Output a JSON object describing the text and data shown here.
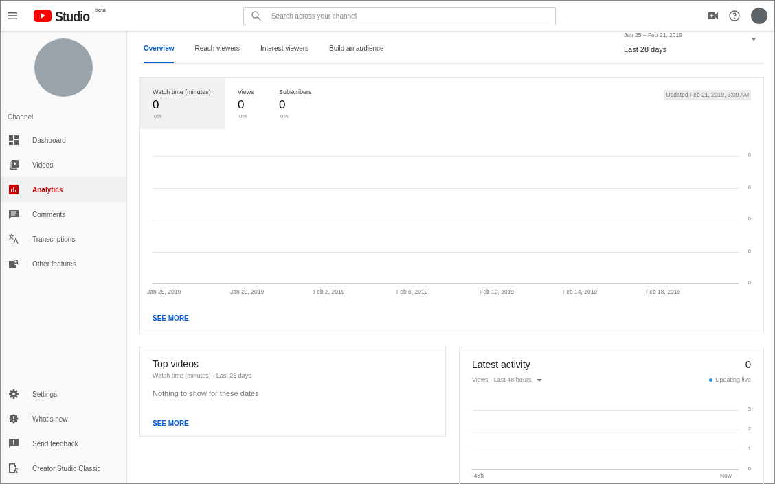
{
  "header": {
    "logo_text": "Studio",
    "logo_badge": "beta",
    "search": {
      "placeholder": "Search across your channel"
    }
  },
  "sidebar": {
    "section_label": "Channel",
    "items": [
      {
        "label": "Dashboard",
        "selected": false
      },
      {
        "label": "Videos",
        "selected": false
      },
      {
        "label": "Analytics",
        "selected": true
      },
      {
        "label": "Comments",
        "selected": false
      },
      {
        "label": "Transcriptions",
        "selected": false
      },
      {
        "label": "Other features",
        "selected": false
      }
    ],
    "footer_items": [
      {
        "label": "Settings"
      },
      {
        "label": "What’s new"
      },
      {
        "label": "Send feedback"
      },
      {
        "label": "Creator Studio Classic"
      }
    ]
  },
  "tabs": [
    {
      "label": "Overview",
      "selected": true
    },
    {
      "label": "Reach viewers",
      "selected": false
    },
    {
      "label": "Interest viewers",
      "selected": false
    },
    {
      "label": "Build an audience",
      "selected": false
    }
  ],
  "date_range": {
    "range": "Jan 25 – Feb 21, 2019",
    "label": "Last 28 days"
  },
  "overview_card": {
    "metrics": [
      {
        "label": "Watch time (minutes)",
        "value": "0",
        "change": "0%",
        "selected": true
      },
      {
        "label": "Views",
        "value": "0",
        "change": "0%",
        "selected": false
      },
      {
        "label": "Subscribers",
        "value": "0",
        "change": "0%",
        "selected": false
      }
    ],
    "updated": "Updated Feb 21, 2019, 3:00 AM",
    "chart": {
      "y_labels": [
        "0",
        "0",
        "0",
        "0",
        "0"
      ],
      "x_labels": [
        "Jan 25, 2019",
        "Jan 29, 2019",
        "Feb 2, 2019",
        "Feb 6, 2019",
        "Feb 10, 2019",
        "Feb 14, 2019",
        "Feb 18, 2019"
      ]
    },
    "link": "SEE MORE"
  },
  "top_videos": {
    "title": "Top videos",
    "subtitle": "Watch time (minutes) · Last 28 days",
    "empty": "Nothing to show for these dates",
    "link": "SEE MORE"
  },
  "latest_activity": {
    "title": "Latest activity",
    "value": "0",
    "subtitle": "Views · Last 48 hours",
    "status": "Updating live",
    "chart": {
      "y_labels": [
        "3",
        "2",
        "1",
        "0"
      ],
      "x_labels": [
        "-48h",
        "Now"
      ]
    }
  }
}
